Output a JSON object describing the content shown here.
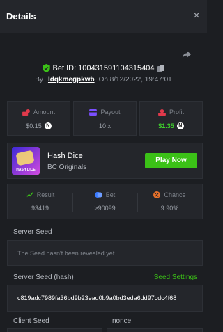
{
  "header": {
    "title": "Details",
    "close_label": "×"
  },
  "bet": {
    "id_label": "Bet ID: 100431591104315404",
    "by_label": "By",
    "username": "ldqkmegpkwb",
    "on_label": "On",
    "datetime": "8/12/2022, 19:47:01"
  },
  "stats": {
    "amount": {
      "label": "Amount",
      "value": "$0.15",
      "currency": "N"
    },
    "payout": {
      "label": "Payout",
      "value": "10 x"
    },
    "profit": {
      "label": "Profit",
      "value": "$1.35",
      "currency": "N"
    }
  },
  "game": {
    "thumb_text": "HASH DICE",
    "name": "Hash Dice",
    "provider": "BC Originals",
    "play_label": "Play Now"
  },
  "result": {
    "result": {
      "label": "Result",
      "value": "93419"
    },
    "bet": {
      "label": "Bet",
      "value": ">90099"
    },
    "chance": {
      "label": "Chance",
      "value": "9.90%"
    }
  },
  "seeds": {
    "server_seed_label": "Server Seed",
    "server_seed_value": "The Seed hasn't been revealed yet.",
    "server_hash_label": "Server Seed (hash)",
    "seed_settings_label": "Seed Settings",
    "server_hash_value": "c819adc7989fa36bd9b23ead0b9a0bd3eda6dd97cdc4f68",
    "client_seed_label": "Client Seed",
    "nonce_label": "nonce"
  },
  "colors": {
    "accent_green": "#3bc117",
    "profit_green": "#3fd22c",
    "amount_red": "#e0394b",
    "payout_purple": "#7b4fff",
    "bet_blue": "#3a7bff",
    "chance_orange": "#e8712b"
  },
  "icons": [
    "close-icon",
    "share-icon",
    "shield-check-icon",
    "copy-icon",
    "money-icon",
    "payout-icon",
    "profit-icon",
    "result-chart-icon",
    "bet-coin-icon",
    "chance-icon"
  ]
}
